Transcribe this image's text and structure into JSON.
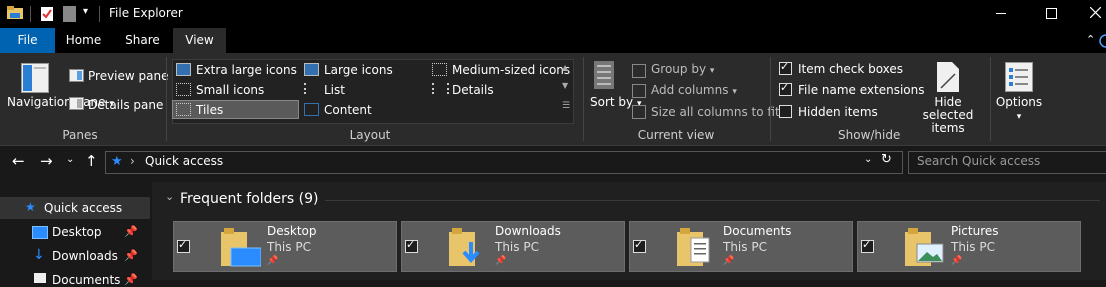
{
  "window": {
    "title": "File Explorer"
  },
  "tabs": {
    "file": "File",
    "home": "Home",
    "share": "Share",
    "view": "View"
  },
  "ribbon": {
    "panes": {
      "navigation_pane": "Navigation pane",
      "preview_pane": "Preview pane",
      "details_pane": "Details pane",
      "group_label": "Panes"
    },
    "layout": {
      "extra_large_icons": "Extra large icons",
      "large_icons": "Large icons",
      "medium_icons": "Medium-sized icons",
      "small_icons": "Small icons",
      "list": "List",
      "details": "Details",
      "tiles": "Tiles",
      "content": "Content",
      "group_label": "Layout"
    },
    "current_view": {
      "sort_by": "Sort by",
      "group_by": "Group by",
      "add_columns": "Add columns",
      "size_all_columns": "Size all columns to fit",
      "group_label": "Current view"
    },
    "show_hide": {
      "item_check_boxes": "Item check boxes",
      "file_name_extensions": "File name extensions",
      "hidden_items": "Hidden items",
      "hide_selected_items": "Hide selected items",
      "group_label": "Show/hide",
      "item_check_boxes_checked": true,
      "file_name_extensions_checked": true,
      "hidden_items_checked": false
    },
    "options": "Options"
  },
  "address": {
    "location": "Quick access",
    "search_placeholder": "Search Quick access"
  },
  "nav": {
    "quick_access": "Quick access",
    "items": [
      {
        "label": "Desktop"
      },
      {
        "label": "Downloads"
      },
      {
        "label": "Documents"
      }
    ]
  },
  "content": {
    "section_title": "Frequent folders (9)",
    "folders": [
      {
        "name": "Desktop",
        "location": "This PC"
      },
      {
        "name": "Downloads",
        "location": "This PC"
      },
      {
        "name": "Documents",
        "location": "This PC"
      },
      {
        "name": "Pictures",
        "location": "This PC"
      }
    ]
  },
  "colors": {
    "accent": "#0063b1",
    "selected_tab_bg": "#2b2b2b",
    "folder_yellow": "#e8c46a"
  }
}
